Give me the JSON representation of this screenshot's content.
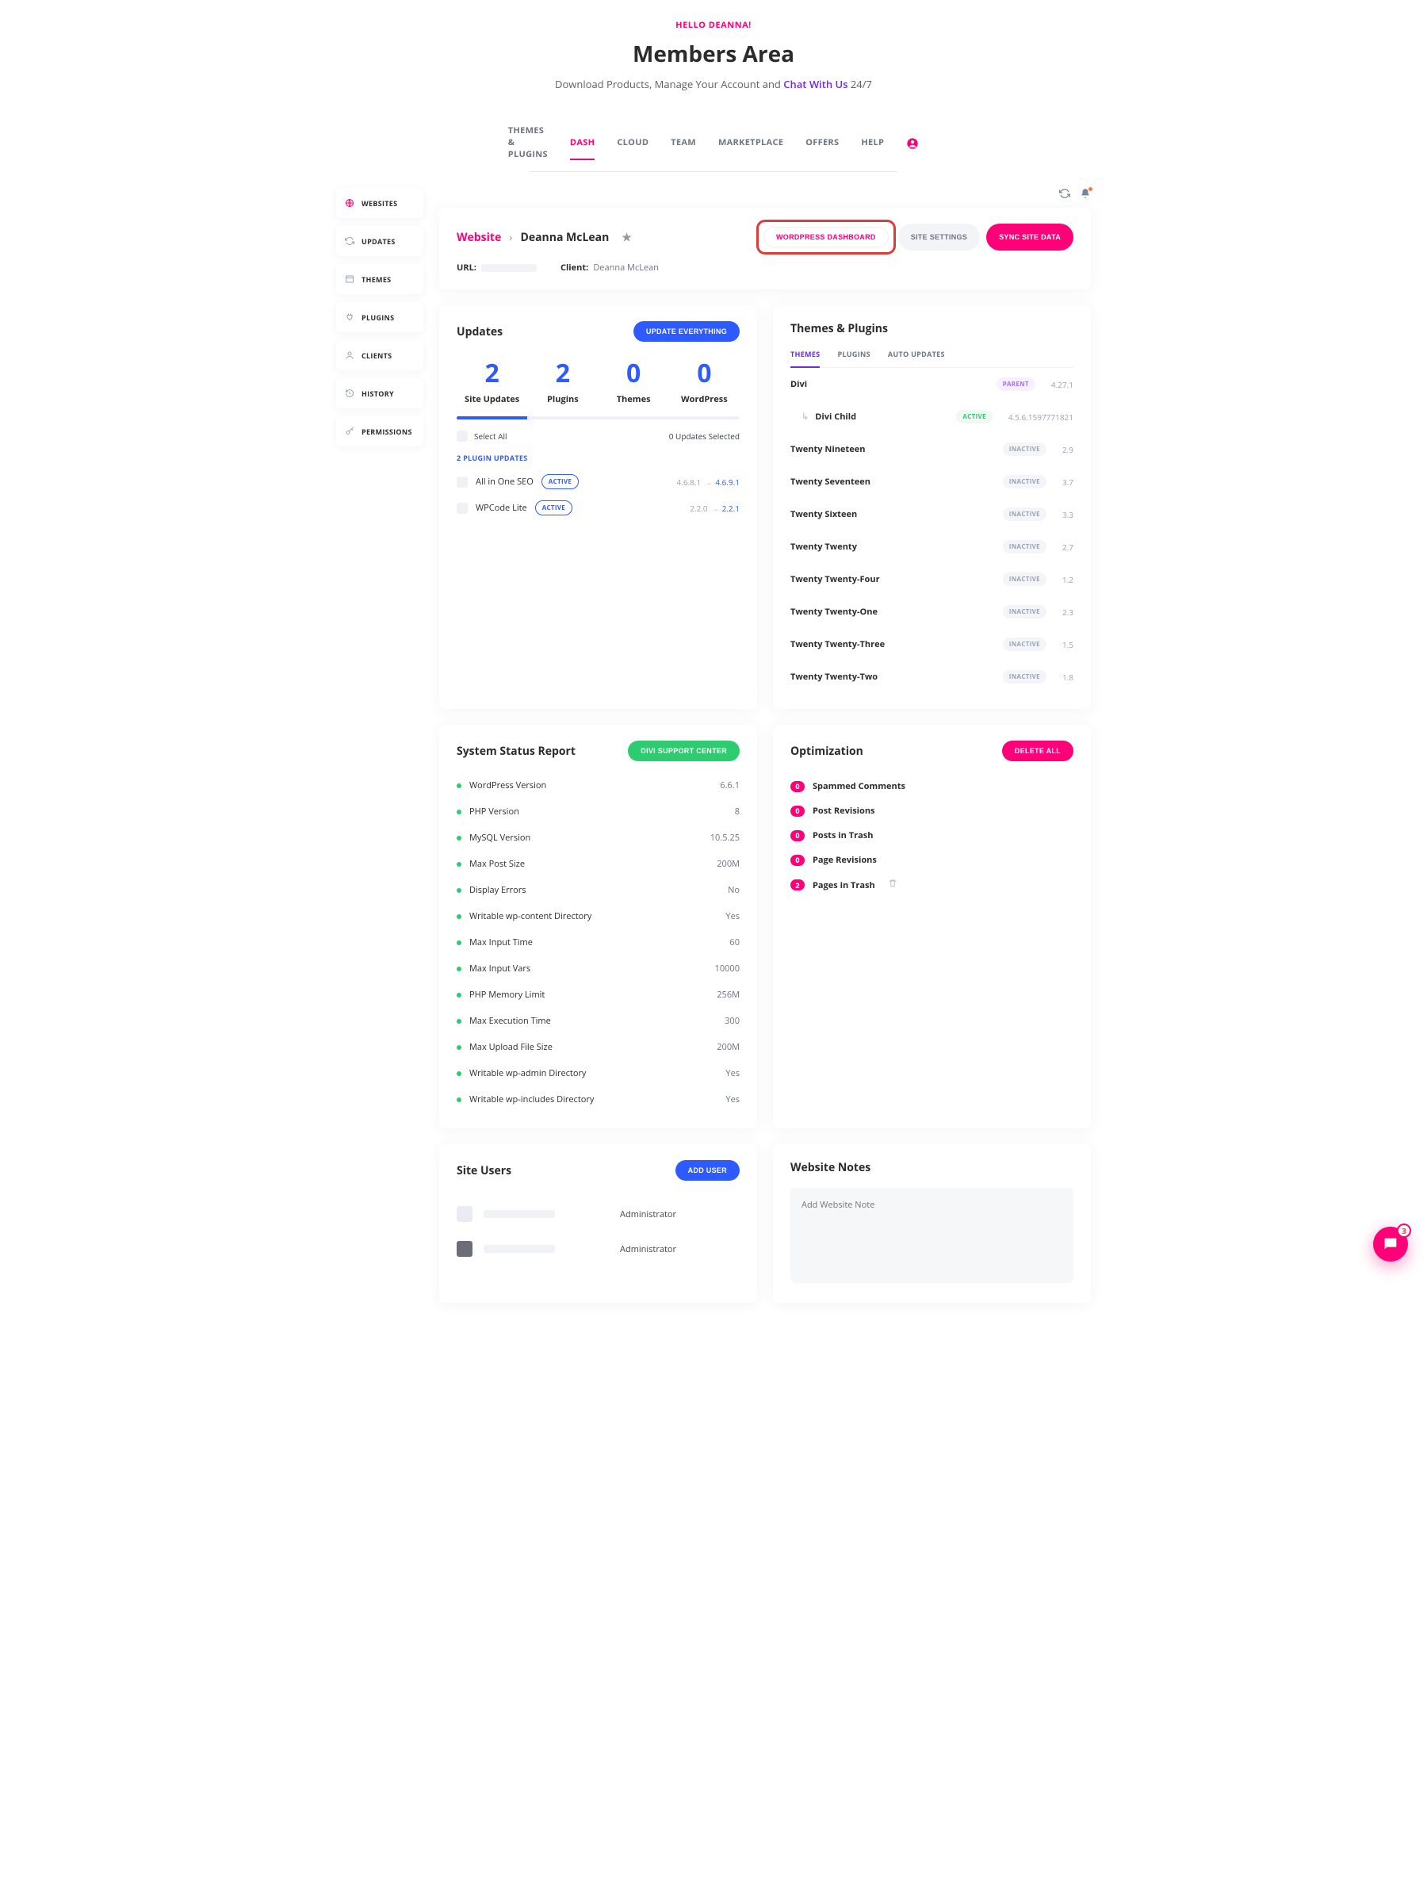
{
  "header": {
    "greeting": "HELLO DEANNA!",
    "title": "Members Area",
    "subtitle_pre": "Download Products, Manage Your Account and ",
    "chat_link": "Chat With Us",
    "subtitle_post": " 24/7"
  },
  "nav": {
    "items": [
      "THEMES & PLUGINS",
      "DASH",
      "CLOUD",
      "TEAM",
      "MARKETPLACE",
      "OFFERS",
      "HELP"
    ],
    "active_index": 1
  },
  "sidebar": {
    "items": [
      {
        "label": "WEBSITES",
        "icon": "globe-icon"
      },
      {
        "label": "UPDATES",
        "icon": "refresh-icon"
      },
      {
        "label": "THEMES",
        "icon": "window-icon"
      },
      {
        "label": "PLUGINS",
        "icon": "plug-icon"
      },
      {
        "label": "CLIENTS",
        "icon": "person-icon"
      },
      {
        "label": "HISTORY",
        "icon": "history-icon"
      },
      {
        "label": "PERMISSIONS",
        "icon": "key-icon"
      }
    ],
    "active_index": 0
  },
  "website_header": {
    "root": "Website",
    "name": "Deanna McLean",
    "btn_wp": "WORDPRESS DASHBOARD",
    "btn_settings": "SITE SETTINGS",
    "btn_sync": "SYNC SITE DATA",
    "url_label": "URL:",
    "client_label": "Client:",
    "client_value": "Deanna McLean"
  },
  "updates": {
    "title": "Updates",
    "btn": "UPDATE EVERYTHING",
    "stats": [
      {
        "num": "2",
        "label": "Site Updates"
      },
      {
        "num": "2",
        "label": "Plugins"
      },
      {
        "num": "0",
        "label": "Themes"
      },
      {
        "num": "0",
        "label": "WordPress"
      }
    ],
    "select_all": "Select All",
    "selected_text": "0 Updates Selected",
    "section_label": "2 PLUGIN UPDATES",
    "items": [
      {
        "name": "All in One SEO",
        "badge": "ACTIVE",
        "from": "4.6.8.1",
        "to": "4.6.9.1"
      },
      {
        "name": "WPCode Lite",
        "badge": "ACTIVE",
        "from": "2.2.0",
        "to": "2.2.1"
      }
    ]
  },
  "themes_plugins": {
    "title": "Themes & Plugins",
    "tabs": [
      "THEMES",
      "PLUGINS",
      "AUTO UPDATES"
    ],
    "active_tab": 0,
    "rows": [
      {
        "name": "Divi",
        "badge": "PARENT",
        "badge_class": "badge-parent",
        "ver": "4.27.1",
        "child": false
      },
      {
        "name": "Divi Child",
        "badge": "ACTIVE",
        "badge_class": "badge-child-active",
        "ver": "4.5.6.1597771821",
        "child": true
      },
      {
        "name": "Twenty Nineteen",
        "badge": "INACTIVE",
        "badge_class": "badge-inactive",
        "ver": "2.9",
        "child": false
      },
      {
        "name": "Twenty Seventeen",
        "badge": "INACTIVE",
        "badge_class": "badge-inactive",
        "ver": "3.7",
        "child": false
      },
      {
        "name": "Twenty Sixteen",
        "badge": "INACTIVE",
        "badge_class": "badge-inactive",
        "ver": "3.3",
        "child": false
      },
      {
        "name": "Twenty Twenty",
        "badge": "INACTIVE",
        "badge_class": "badge-inactive",
        "ver": "2.7",
        "child": false
      },
      {
        "name": "Twenty Twenty-Four",
        "badge": "INACTIVE",
        "badge_class": "badge-inactive",
        "ver": "1.2",
        "child": false
      },
      {
        "name": "Twenty Twenty-One",
        "badge": "INACTIVE",
        "badge_class": "badge-inactive",
        "ver": "2.3",
        "child": false
      },
      {
        "name": "Twenty Twenty-Three",
        "badge": "INACTIVE",
        "badge_class": "badge-inactive",
        "ver": "1.5",
        "child": false
      },
      {
        "name": "Twenty Twenty-Two",
        "badge": "INACTIVE",
        "badge_class": "badge-inactive",
        "ver": "1.8",
        "child": false
      }
    ]
  },
  "status": {
    "title": "System Status Report",
    "btn": "DIVI SUPPORT CENTER",
    "rows": [
      {
        "label": "WordPress Version",
        "value": "6.6.1"
      },
      {
        "label": "PHP Version",
        "value": "8"
      },
      {
        "label": "MySQL Version",
        "value": "10.5.25"
      },
      {
        "label": "Max Post Size",
        "value": "200M"
      },
      {
        "label": "Display Errors",
        "value": "No"
      },
      {
        "label": "Writable wp-content Directory",
        "value": "Yes"
      },
      {
        "label": "Max Input Time",
        "value": "60"
      },
      {
        "label": "Max Input Vars",
        "value": "10000"
      },
      {
        "label": "PHP Memory Limit",
        "value": "256M"
      },
      {
        "label": "Max Execution Time",
        "value": "300"
      },
      {
        "label": "Max Upload File Size",
        "value": "200M"
      },
      {
        "label": "Writable wp-admin Directory",
        "value": "Yes"
      },
      {
        "label": "Writable wp-includes Directory",
        "value": "Yes"
      }
    ]
  },
  "optimization": {
    "title": "Optimization",
    "btn": "DELETE ALL",
    "rows": [
      {
        "count": "0",
        "label": "Spammed Comments",
        "trash": false
      },
      {
        "count": "0",
        "label": "Post Revisions",
        "trash": false
      },
      {
        "count": "0",
        "label": "Posts in Trash",
        "trash": false
      },
      {
        "count": "0",
        "label": "Page Revisions",
        "trash": false
      },
      {
        "count": "2",
        "label": "Pages in Trash",
        "trash": true
      }
    ]
  },
  "site_users": {
    "title": "Site Users",
    "btn": "ADD USER",
    "rows": [
      {
        "role": "Administrator"
      },
      {
        "role": "Administrator"
      }
    ]
  },
  "notes": {
    "title": "Website Notes",
    "placeholder": "Add Website Note"
  },
  "fab": {
    "badge": "3"
  }
}
